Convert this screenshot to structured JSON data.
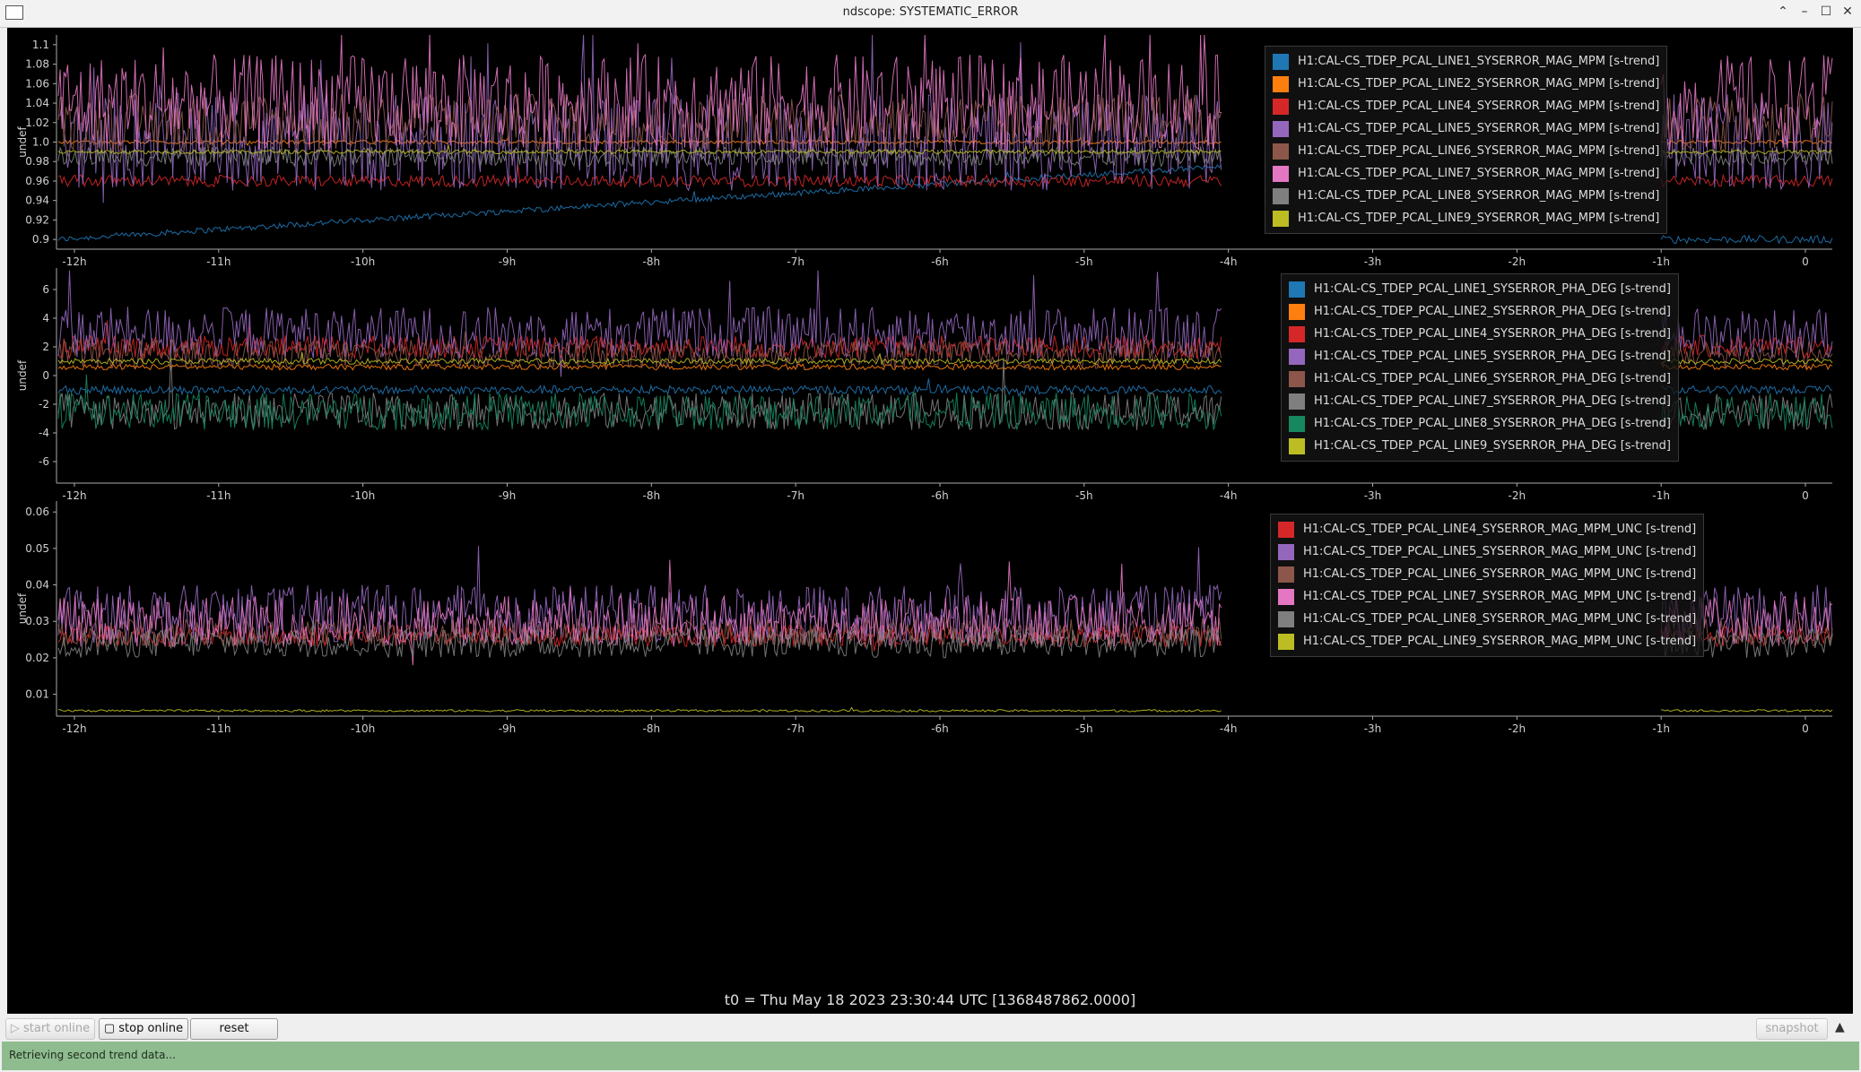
{
  "window": {
    "title": "ndscope: SYSTEMATIC_ERROR",
    "buttons": [
      "⌃",
      "–",
      "☐",
      "✕"
    ]
  },
  "plots": [
    {
      "ylabel": "undef",
      "yticks": [
        "0.9",
        "0.92",
        "0.94",
        "0.96",
        "0.98",
        "1.0",
        "1.02",
        "1.04",
        "1.06",
        "1.08",
        "1.1"
      ],
      "ylim": [
        0.89,
        1.11
      ],
      "series": [
        {
          "name": "H1:CAL-CS_TDEP_PCAL_LINE1_SYSERROR_MAG_MPM [s-trend]",
          "color": "#1f77b4"
        },
        {
          "name": "H1:CAL-CS_TDEP_PCAL_LINE2_SYSERROR_MAG_MPM [s-trend]",
          "color": "#ff7f0e"
        },
        {
          "name": "H1:CAL-CS_TDEP_PCAL_LINE4_SYSERROR_MAG_MPM [s-trend]",
          "color": "#d62728"
        },
        {
          "name": "H1:CAL-CS_TDEP_PCAL_LINE5_SYSERROR_MAG_MPM [s-trend]",
          "color": "#9467bd"
        },
        {
          "name": "H1:CAL-CS_TDEP_PCAL_LINE6_SYSERROR_MAG_MPM [s-trend]",
          "color": "#8c564b"
        },
        {
          "name": "H1:CAL-CS_TDEP_PCAL_LINE7_SYSERROR_MAG_MPM [s-trend]",
          "color": "#e377c2"
        },
        {
          "name": "H1:CAL-CS_TDEP_PCAL_LINE8_SYSERROR_MAG_MPM [s-trend]",
          "color": "#7f7f7f"
        },
        {
          "name": "H1:CAL-CS_TDEP_PCAL_LINE9_SYSERROR_MAG_MPM [s-trend]",
          "color": "#bcbd22"
        }
      ]
    },
    {
      "ylabel": "undef",
      "yticks": [
        "-6",
        "-4",
        "-2",
        "0",
        "2",
        "4",
        "6"
      ],
      "ylim": [
        -7.5,
        7.5
      ],
      "series": [
        {
          "name": "H1:CAL-CS_TDEP_PCAL_LINE1_SYSERROR_PHA_DEG [s-trend]",
          "color": "#1f77b4"
        },
        {
          "name": "H1:CAL-CS_TDEP_PCAL_LINE2_SYSERROR_PHA_DEG [s-trend]",
          "color": "#ff7f0e"
        },
        {
          "name": "H1:CAL-CS_TDEP_PCAL_LINE4_SYSERROR_PHA_DEG [s-trend]",
          "color": "#d62728"
        },
        {
          "name": "H1:CAL-CS_TDEP_PCAL_LINE5_SYSERROR_PHA_DEG [s-trend]",
          "color": "#9467bd"
        },
        {
          "name": "H1:CAL-CS_TDEP_PCAL_LINE6_SYSERROR_PHA_DEG [s-trend]",
          "color": "#8c564b"
        },
        {
          "name": "H1:CAL-CS_TDEP_PCAL_LINE7_SYSERROR_PHA_DEG [s-trend]",
          "color": "#7f7f7f"
        },
        {
          "name": "H1:CAL-CS_TDEP_PCAL_LINE8_SYSERROR_PHA_DEG [s-trend]",
          "color": "#17875f"
        },
        {
          "name": "H1:CAL-CS_TDEP_PCAL_LINE9_SYSERROR_PHA_DEG [s-trend]",
          "color": "#bcbd22"
        }
      ]
    },
    {
      "ylabel": "undef",
      "yticks": [
        "0.01",
        "0.02",
        "0.03",
        "0.04",
        "0.05",
        "0.06"
      ],
      "ylim": [
        0.004,
        0.063
      ],
      "series": [
        {
          "name": "H1:CAL-CS_TDEP_PCAL_LINE4_SYSERROR_MAG_MPM_UNC [s-trend]",
          "color": "#d62728"
        },
        {
          "name": "H1:CAL-CS_TDEP_PCAL_LINE5_SYSERROR_MAG_MPM_UNC [s-trend]",
          "color": "#9467bd"
        },
        {
          "name": "H1:CAL-CS_TDEP_PCAL_LINE6_SYSERROR_MAG_MPM_UNC [s-trend]",
          "color": "#8c564b"
        },
        {
          "name": "H1:CAL-CS_TDEP_PCAL_LINE7_SYSERROR_MAG_MPM_UNC [s-trend]",
          "color": "#e377c2"
        },
        {
          "name": "H1:CAL-CS_TDEP_PCAL_LINE8_SYSERROR_MAG_MPM_UNC [s-trend]",
          "color": "#7f7f7f"
        },
        {
          "name": "H1:CAL-CS_TDEP_PCAL_LINE9_SYSERROR_MAG_MPM_UNC [s-trend]",
          "color": "#bcbd22"
        }
      ]
    }
  ],
  "xticks": [
    "-12h",
    "-11h",
    "-10h",
    "-9h",
    "-8h",
    "-7h",
    "-6h",
    "-5h",
    "-4h",
    "-3h",
    "-2h",
    "-1h",
    "0"
  ],
  "xlim_hours": [
    -12.2,
    0
  ],
  "t0_label": "t0 = Thu May 18 2023 23:30:44 UTC [1368487862.0000]",
  "controls": {
    "start_online": "start online",
    "stop_online": "stop online",
    "reset": "reset",
    "snapshot": "snapshot",
    "collapse": "▲"
  },
  "status": "Retrieving second trend data..."
}
